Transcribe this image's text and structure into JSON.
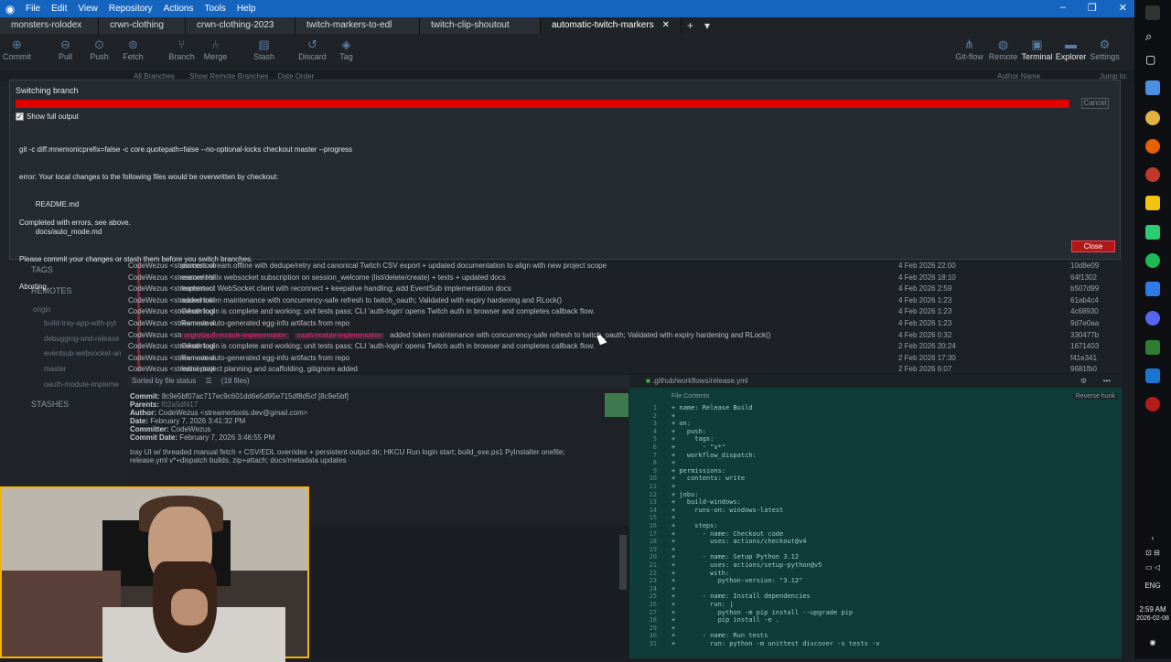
{
  "menu": {
    "items": [
      "File",
      "Edit",
      "View",
      "Repository",
      "Actions",
      "Tools",
      "Help"
    ]
  },
  "tabs": [
    {
      "label": "monsters-rolodex"
    },
    {
      "label": "crwn-clothing"
    },
    {
      "label": "crwn-clothing-2023"
    },
    {
      "label": "twitch-markers-to-edl"
    },
    {
      "label": "twitch-clip-shoutout"
    },
    {
      "label": "automatic-twitch-markers"
    }
  ],
  "toolbar": {
    "left": [
      "Commit",
      "Pull",
      "Push",
      "Fetch",
      "Branch",
      "Merge",
      "Stash",
      "Discard",
      "Tag"
    ],
    "right": [
      "Git-flow",
      "Remote",
      "Terminal",
      "Explorer",
      "Settings"
    ]
  },
  "filters": {
    "branches": "All Branches",
    "show_remote": "Show Remote Branches",
    "order": "Date Order",
    "author": "Author Name",
    "jump": "Jump to:"
  },
  "dialog": {
    "title": "Switching branch",
    "cancel": "Cancel",
    "show_full_output": "Show full output",
    "output_lines": [
      "git -c diff.mnemonicprefix=false -c core.quotepath=false --no-optional-locks checkout master --progress",
      "error: Your local changes to the following files would be overwritten by checkout:",
      "        README.md",
      "        docs/auto_mode.md",
      "Please commit your changes or stash them before you switch branches.",
      "Aborting"
    ],
    "status": "Completed with errors, see above.",
    "close": "Close"
  },
  "sidebar": {
    "tags": "TAGS",
    "remotes": "REMOTES",
    "origin": "origin",
    "branches": [
      "build-tray-app-with-pyt",
      "debugging-and-release",
      "eventsub-websocket-an",
      "master",
      "oauth-module-impleme"
    ],
    "stashes": "STASHES"
  },
  "commits": [
    {
      "msg": "process stream.offline with dedupe/retry and canonical Twitch CSV export + updated documentation to align with new project scope",
      "date": "4 Feb 2026 22:00",
      "author": "CodeWezus <streamertool",
      "hash": "10d8e09"
    },
    {
      "msg": "ensure Helix websocket subscription on session_welcome (list/delete/create) + tests + updated docs",
      "date": "4 Feb 2026 18:10",
      "author": "CodeWezus <streamertool",
      "hash": "64f1302"
    },
    {
      "msg": "Implement WebSocket client with reconnect + keepalive handling; add EventSub implementation docs",
      "date": "4 Feb 2026 2:59",
      "author": "CodeWezus <streamertool",
      "hash": "b507d99"
    },
    {
      "msg": "added token maintenance with concurrency-safe refresh to twitch_oauth; Validated with expiry hardening and RLock()",
      "date": "4 Feb 2026 1:23",
      "author": "CodeWezus <streamertool",
      "hash": "61ab4c4"
    },
    {
      "msg": "OAuth login is complete and working; unit tests pass; CLI 'auth-login' opens Twitch auth in browser and completes callback flow.",
      "date": "4 Feb 2026 1:23",
      "author": "CodeWezus <streamertool",
      "hash": "4c68930"
    },
    {
      "msg": "Remove auto-generated egg-info artifacts from repo",
      "date": "4 Feb 2026 1:23",
      "author": "CodeWezus <streamertool",
      "hash": "9d7e0aa"
    },
    {
      "msg": "added token maintenance with concurrency-safe refresh to twitch_oauth; Validated with expiry hardening and RLock()",
      "date": "4 Feb 2026 0:32",
      "author": "CodeWezus <streamertool",
      "hash": "330477b",
      "badges": [
        "origin/oauth-module-implementation",
        "oauth-module-implementation"
      ]
    },
    {
      "msg": "OAuth login is complete and working; unit tests pass; CLI 'auth-login' opens Twitch auth in browser and completes callback flow.",
      "date": "2 Feb 2026 20:24",
      "author": "CodeWezus <streamertool",
      "hash": "1671403"
    },
    {
      "msg": "Remove auto-generated egg-info artifacts from repo",
      "date": "2 Feb 2026 17:30",
      "author": "CodeWezus <streamertool",
      "hash": "f41e341"
    },
    {
      "msg": "Initial project planning and scaffolding, gitignore added",
      "date": "2 Feb 2026 6:07",
      "author": "CodeWezus <streamertool",
      "hash": "9681fb0"
    }
  ],
  "details": {
    "sort": "Sorted by file status",
    "files": "(18 files)",
    "commit_label": "Commit:",
    "commit": "8c9e5bf07ac717ec9c601dd6e5d95e715df8d5cf [8c9e5bf]",
    "parents_label": "Parents:",
    "parents": "f02a5df417",
    "author_label": "Author:",
    "author": "CodeWezus <streamertools.dev@gmail.com>",
    "date_label": "Date:",
    "date": "February 7, 2026 3:41:32 PM",
    "committer_label": "Committer:",
    "committer": "CodeWezus",
    "commit_date_label": "Commit Date:",
    "commit_date": "February 7, 2026 3:46:55 PM",
    "message_1": "tray UI w/ threaded manual fetch + CSV/EDL overrides + persistent output dir; HKCU Run login start; build_exe.ps1 PyInstaller onefile;",
    "message_2": "release.yml v*+dispatch builds, zip+attach; docs/metadata updates"
  },
  "code": {
    "file": ".github/workflows/release.yml",
    "contents_label": "File Contents",
    "reverse_hunk": "Reverse hunk",
    "lines": [
      {
        "n": "1",
        "t": "+ name: Release Build"
      },
      {
        "n": "2",
        "t": "+"
      },
      {
        "n": "3",
        "t": "+ on:"
      },
      {
        "n": "4",
        "t": "+   push:"
      },
      {
        "n": "5",
        "t": "+     tags:"
      },
      {
        "n": "6",
        "t": "+       - \"v*\""
      },
      {
        "n": "7",
        "t": "+   workflow_dispatch:"
      },
      {
        "n": "8",
        "t": "+"
      },
      {
        "n": "9",
        "t": "+ permissions:"
      },
      {
        "n": "10",
        "t": "+   contents: write"
      },
      {
        "n": "11",
        "t": "+"
      },
      {
        "n": "12",
        "t": "+ jobs:"
      },
      {
        "n": "13",
        "t": "+   build-windows:"
      },
      {
        "n": "14",
        "t": "+     runs-on: windows-latest"
      },
      {
        "n": "15",
        "t": "+"
      },
      {
        "n": "16",
        "t": "+     steps:"
      },
      {
        "n": "17",
        "t": "+       - name: Checkout code"
      },
      {
        "n": "18",
        "t": "+         uses: actions/checkout@v4"
      },
      {
        "n": "19",
        "t": "+"
      },
      {
        "n": "20",
        "t": "+       - name: Setup Python 3.12"
      },
      {
        "n": "21",
        "t": "+         uses: actions/setup-python@v5"
      },
      {
        "n": "22",
        "t": "+         with:"
      },
      {
        "n": "23",
        "t": "+           python-version: \"3.12\""
      },
      {
        "n": "24",
        "t": "+"
      },
      {
        "n": "25",
        "t": "+       - name: Install dependencies"
      },
      {
        "n": "26",
        "t": "+         run: |"
      },
      {
        "n": "27",
        "t": "+           python -m pip install --upgrade pip"
      },
      {
        "n": "28",
        "t": "+           pip install -e ."
      },
      {
        "n": "29",
        "t": "+"
      },
      {
        "n": "30",
        "t": "+       - name: Run tests"
      },
      {
        "n": "31",
        "t": "+         run: python -m unittest discover -s tests -v"
      }
    ]
  },
  "taskbar": {
    "lang": "ENG",
    "time": "2:59 AM",
    "date": "2026-02-08"
  },
  "colors": {
    "accent": "#1565c0",
    "error_bar": "#e00000",
    "close_button": "#b11717",
    "diff_bg": "#0f3b38"
  }
}
